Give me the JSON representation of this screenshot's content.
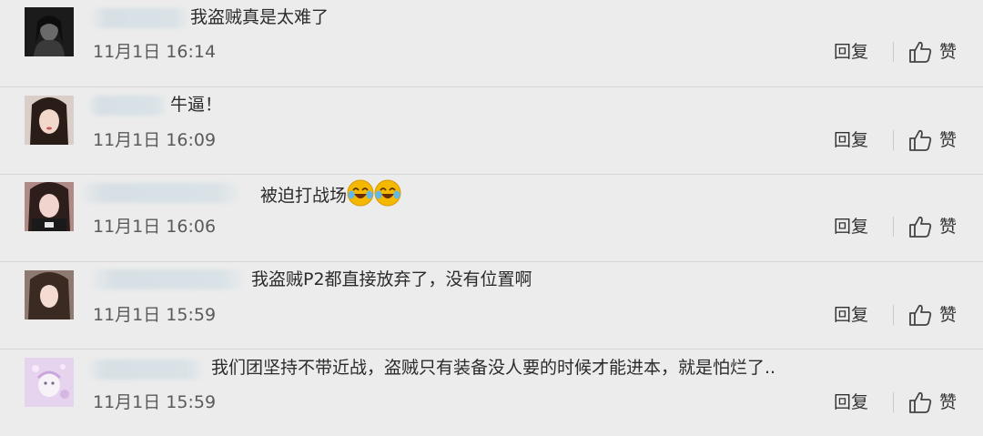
{
  "comments": [
    {
      "text": "我盗贼真是太难了",
      "time": "11月1日 16:14",
      "reply_label": "回复",
      "like_label": "赞"
    },
    {
      "text": "牛逼！",
      "time": "11月1日 16:09",
      "reply_label": "回复",
      "like_label": "赞"
    },
    {
      "text": "被迫打战场",
      "emoji": [
        "laugh-cry-emoji",
        "laugh-cry-emoji"
      ],
      "time": "11月1日 16:06",
      "reply_label": "回复",
      "like_label": "赞"
    },
    {
      "text": "我盗贼P2都直接放弃了，没有位置啊",
      "time": "11月1日 15:59",
      "reply_label": "回复",
      "like_label": "赞"
    },
    {
      "text": "我们团坚持不带近战，盗贼只有装备没人要的时候才能进本，就是怕烂了..",
      "time": "11月1日 15:59",
      "reply_label": "回复",
      "like_label": "赞"
    }
  ],
  "icons": {
    "reply": "none",
    "like": "thumbs-up-icon"
  },
  "colors": {
    "background": "#ececec",
    "text": "#2b2b2b",
    "divider": "#d6d6d6",
    "emoji": "#f5b800"
  }
}
